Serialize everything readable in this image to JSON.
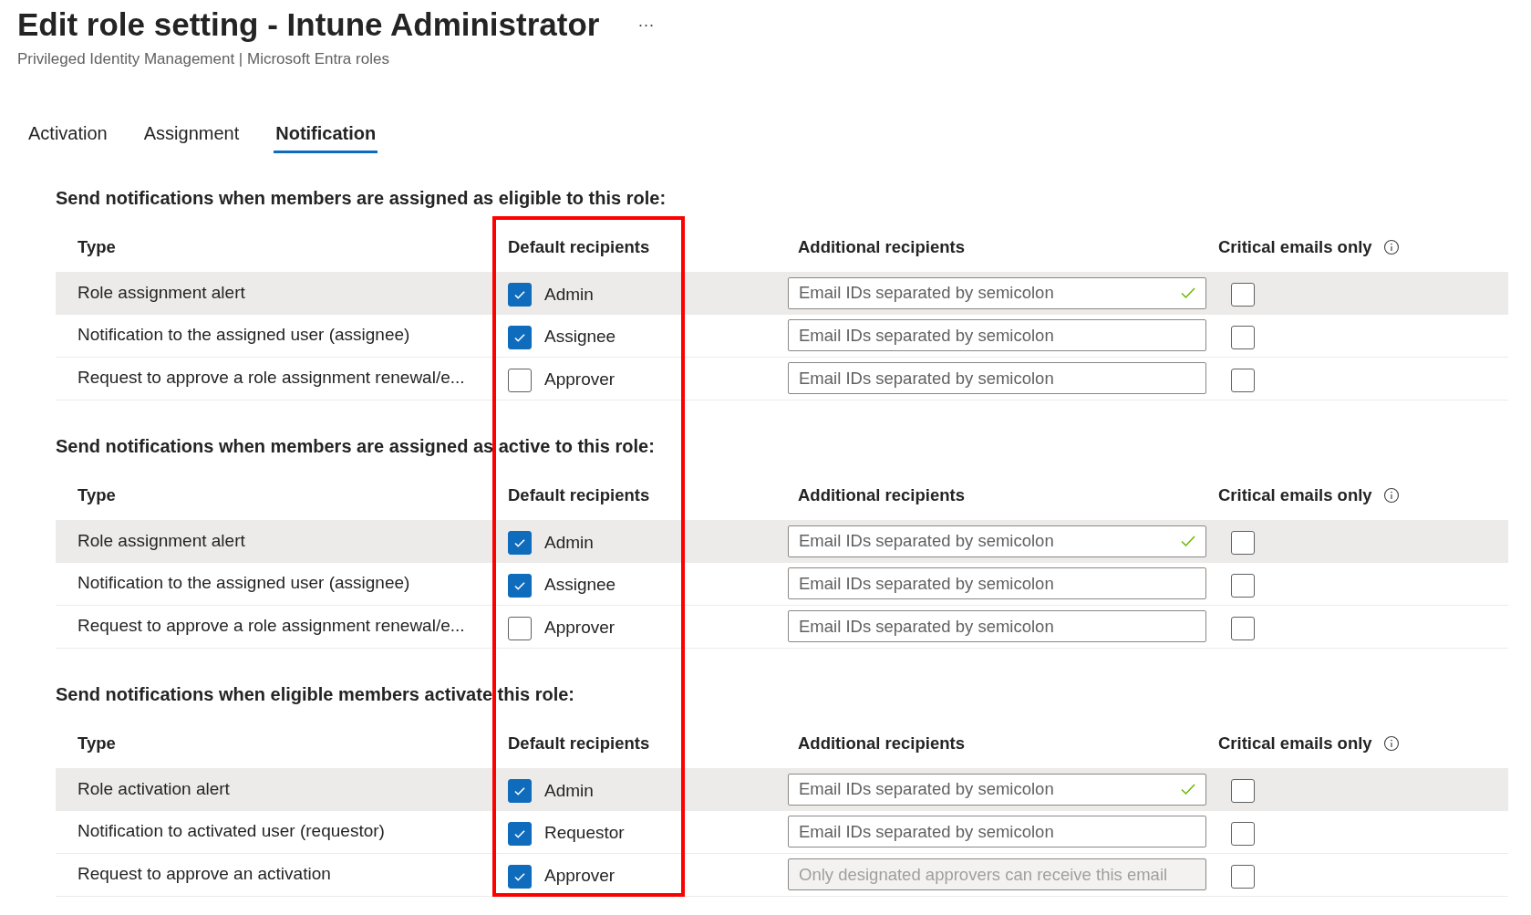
{
  "header": {
    "title": "Edit role setting - Intune Administrator",
    "more": "···",
    "subtitle": "Privileged Identity Management | Microsoft Entra roles"
  },
  "tabs": [
    {
      "label": "Activation",
      "selected": false
    },
    {
      "label": "Assignment",
      "selected": false
    },
    {
      "label": "Notification",
      "selected": true
    }
  ],
  "sections": [
    {
      "heading": "Send notifications when members are assigned as eligible to this role:",
      "columns": [
        "Type",
        "Default recipients",
        "Additional recipients",
        "Critical emails only"
      ],
      "rows": [
        {
          "type": "Role assignment alert",
          "highlighted": true,
          "recipient": "Admin",
          "recipient_checked": true,
          "placeholder": "Email IDs separated by semicolon",
          "validated": true,
          "disabled": false,
          "critical_checked": false
        },
        {
          "type": "Notification to the assigned user (assignee)",
          "highlighted": false,
          "recipient": "Assignee",
          "recipient_checked": true,
          "placeholder": "Email IDs separated by semicolon",
          "validated": false,
          "disabled": false,
          "critical_checked": false
        },
        {
          "type": "Request to approve a role assignment renewal/e...",
          "highlighted": false,
          "recipient": "Approver",
          "recipient_checked": false,
          "placeholder": "Email IDs separated by semicolon",
          "validated": false,
          "disabled": false,
          "critical_checked": false
        }
      ]
    },
    {
      "heading": "Send notifications when members are assigned as active to this role:",
      "columns": [
        "Type",
        "Default recipients",
        "Additional recipients",
        "Critical emails only"
      ],
      "rows": [
        {
          "type": "Role assignment alert",
          "highlighted": true,
          "recipient": "Admin",
          "recipient_checked": true,
          "placeholder": "Email IDs separated by semicolon",
          "validated": true,
          "disabled": false,
          "critical_checked": false
        },
        {
          "type": "Notification to the assigned user (assignee)",
          "highlighted": false,
          "recipient": "Assignee",
          "recipient_checked": true,
          "placeholder": "Email IDs separated by semicolon",
          "validated": false,
          "disabled": false,
          "critical_checked": false
        },
        {
          "type": "Request to approve a role assignment renewal/e...",
          "highlighted": false,
          "recipient": "Approver",
          "recipient_checked": false,
          "placeholder": "Email IDs separated by semicolon",
          "validated": false,
          "disabled": false,
          "critical_checked": false
        }
      ]
    },
    {
      "heading": "Send notifications when eligible members activate this role:",
      "columns": [
        "Type",
        "Default recipients",
        "Additional recipients",
        "Critical emails only"
      ],
      "rows": [
        {
          "type": "Role activation alert",
          "highlighted": true,
          "recipient": "Admin",
          "recipient_checked": true,
          "placeholder": "Email IDs separated by semicolon",
          "validated": true,
          "disabled": false,
          "critical_checked": false
        },
        {
          "type": "Notification to activated user (requestor)",
          "highlighted": false,
          "recipient": "Requestor",
          "recipient_checked": true,
          "placeholder": "Email IDs separated by semicolon",
          "validated": false,
          "disabled": false,
          "critical_checked": false
        },
        {
          "type": "Request to approve an activation",
          "highlighted": false,
          "recipient": "Approver",
          "recipient_checked": true,
          "placeholder": "Only designated approvers can receive this email",
          "validated": false,
          "disabled": true,
          "critical_checked": false
        }
      ]
    }
  ]
}
